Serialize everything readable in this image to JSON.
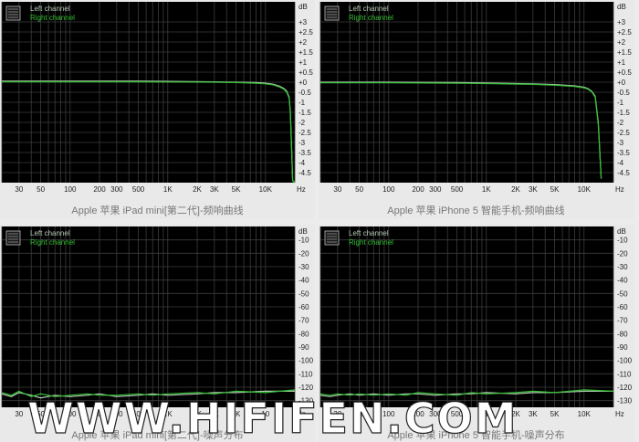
{
  "legend": {
    "left": "Left channel",
    "right": "Right channel"
  },
  "colors": {
    "plot_bg": "#000000",
    "grid": "#3c3c3c",
    "left": "#b7c9b7",
    "right": "#33c033"
  },
  "watermark": "WWW.HIFIFEN.COM",
  "chart_data": [
    {
      "type": "line",
      "title": "",
      "caption": "Apple 苹果 iPad mini[第二代]-频响曲线",
      "unit_label": "dB",
      "x_unit_label": "Hz",
      "x_scale": "log",
      "xlim": [
        20,
        20000
      ],
      "ylim": [
        -5,
        4
      ],
      "x_ticks": [
        30,
        50,
        100,
        200,
        300,
        500,
        1000,
        2000,
        3000,
        5000,
        10000
      ],
      "x_tick_labels": [
        "30",
        "50",
        "100",
        "200",
        "300",
        "500",
        "1K",
        "2K",
        "3K",
        "5K",
        "10K"
      ],
      "y_ticks": [
        3,
        2.5,
        2,
        1.5,
        1,
        0.5,
        0,
        -0.5,
        -1,
        -1.5,
        -2,
        -2.5,
        -3,
        -3.5,
        -4,
        -4.5
      ],
      "y_tick_labels": [
        "+3",
        "+2.5",
        "+2",
        "+1.5",
        "+1",
        "+0.5",
        "+0",
        "-0.5",
        "-1",
        "-1.5",
        "-2",
        "-2.5",
        "-3",
        "-3.5",
        "-4",
        "-4.5"
      ],
      "series": [
        {
          "name": "Left channel",
          "x": [
            20,
            50,
            100,
            500,
            1000,
            3000,
            5000,
            8000,
            10000,
            12000,
            14000,
            15500,
            16500,
            17500,
            18000,
            18500,
            19000,
            20000
          ],
          "y": [
            0.05,
            0.05,
            0.05,
            0.05,
            0.04,
            0.02,
            0,
            -0.02,
            -0.05,
            -0.1,
            -0.2,
            -0.32,
            -0.45,
            -0.75,
            -1.5,
            -3.2,
            -4.9,
            -5
          ]
        },
        {
          "name": "Right channel",
          "x": [
            20,
            50,
            100,
            500,
            1000,
            3000,
            5000,
            8000,
            10000,
            12000,
            14000,
            15500,
            16500,
            17500,
            18000,
            18500,
            19000,
            20000
          ],
          "y": [
            0.02,
            0.02,
            0.02,
            0.02,
            0.01,
            0,
            -0.02,
            -0.05,
            -0.08,
            -0.13,
            -0.24,
            -0.36,
            -0.5,
            -0.8,
            -1.6,
            -3.3,
            -4.9,
            -5
          ]
        }
      ]
    },
    {
      "type": "line",
      "title": "",
      "caption": "Apple 苹果 iPhone 5 智能手机-频响曲线",
      "unit_label": "dB",
      "x_unit_label": "Hz",
      "x_scale": "log",
      "xlim": [
        20,
        20000
      ],
      "ylim": [
        -5,
        4
      ],
      "x_ticks": [
        30,
        50,
        100,
        200,
        300,
        500,
        1000,
        2000,
        3000,
        5000,
        10000
      ],
      "x_tick_labels": [
        "30",
        "50",
        "100",
        "200",
        "300",
        "500",
        "1K",
        "2K",
        "3K",
        "5K",
        "10K"
      ],
      "y_ticks": [
        3,
        2.5,
        2,
        1.5,
        1,
        0.5,
        0,
        -0.5,
        -1,
        -1.5,
        -2,
        -2.5,
        -3,
        -3.5,
        -4,
        -4.5
      ],
      "y_tick_labels": [
        "+3",
        "+2.5",
        "+2",
        "+1.5",
        "+1",
        "+0.5",
        "+0",
        "-0.5",
        "-1",
        "-1.5",
        "-2",
        "-2.5",
        "-3",
        "-3.5",
        "-4",
        "-4.5"
      ],
      "series": [
        {
          "name": "Left channel",
          "x": [
            20,
            50,
            100,
            500,
            1000,
            3000,
            5000,
            8000,
            10000,
            11000,
            12000,
            13000,
            14000,
            15000
          ],
          "y": [
            0.0,
            0.0,
            0.0,
            -0.02,
            -0.04,
            -0.08,
            -0.12,
            -0.18,
            -0.25,
            -0.32,
            -0.45,
            -0.7,
            -2.0,
            -4.8
          ]
        },
        {
          "name": "Right channel",
          "x": [
            20,
            50,
            100,
            500,
            1000,
            3000,
            5000,
            8000,
            10000,
            11000,
            12000,
            13000,
            14000,
            15000
          ],
          "y": [
            -0.03,
            -0.03,
            -0.03,
            -0.05,
            -0.07,
            -0.11,
            -0.15,
            -0.21,
            -0.28,
            -0.35,
            -0.48,
            -0.75,
            -2.1,
            -4.8
          ]
        }
      ]
    },
    {
      "type": "line",
      "title": "",
      "caption": "Apple 苹果 iPad mini[第二代]-噪声分布",
      "unit_label": "dB",
      "x_unit_label": "Hz",
      "x_scale": "log",
      "xlim": [
        20,
        20000
      ],
      "ylim": [
        -135,
        0
      ],
      "x_ticks": [
        30,
        50,
        100,
        200,
        300,
        500,
        1000,
        2000,
        3000,
        5000,
        10000
      ],
      "x_tick_labels": [
        "30",
        "50",
        "100",
        "200",
        "300",
        "500",
        "1K",
        "2K",
        "3K",
        "5K",
        "10"
      ],
      "y_ticks": [
        -10,
        -20,
        -30,
        -40,
        -50,
        -60,
        -70,
        -80,
        -90,
        -100,
        -110,
        -120,
        -130
      ],
      "y_tick_labels": [
        "-10",
        "-20",
        "-30",
        "-40",
        "-50",
        "-60",
        "-70",
        "-80",
        "-90",
        "-100",
        "-110",
        "-120",
        "-130"
      ],
      "series": [
        {
          "name": "Left channel",
          "x": [
            20,
            25,
            30,
            40,
            50,
            70,
            100,
            150,
            200,
            300,
            500,
            700,
            1000,
            2000,
            3000,
            5000,
            10000,
            20000
          ],
          "y": [
            -125,
            -127,
            -124,
            -126,
            -128,
            -126,
            -127,
            -126,
            -125,
            -127,
            -126,
            -125,
            -126,
            -125,
            -124,
            -124,
            -123,
            -123
          ]
        },
        {
          "name": "Right channel",
          "x": [
            20,
            25,
            30,
            40,
            50,
            70,
            100,
            150,
            200,
            300,
            500,
            700,
            1000,
            2000,
            3000,
            5000,
            10000,
            20000
          ],
          "y": [
            -124,
            -126,
            -123,
            -127,
            -125,
            -127,
            -126,
            -125,
            -126,
            -126,
            -125,
            -126,
            -125,
            -124,
            -125,
            -123,
            -124,
            -122
          ]
        }
      ]
    },
    {
      "type": "line",
      "title": "",
      "caption": "Apple 苹果 iPhone 5 智能手机-噪声分布",
      "unit_label": "dB",
      "x_unit_label": "Hz",
      "x_scale": "log",
      "xlim": [
        20,
        20000
      ],
      "ylim": [
        -135,
        0
      ],
      "x_ticks": [
        30,
        50,
        100,
        200,
        300,
        500,
        1000,
        2000,
        3000,
        5000,
        10000
      ],
      "x_tick_labels": [
        "30",
        "50",
        "100",
        "200",
        "300",
        "500",
        "1K",
        "2K",
        "3K",
        "5K",
        "10K"
      ],
      "y_ticks": [
        -10,
        -20,
        -30,
        -40,
        -50,
        -60,
        -70,
        -80,
        -90,
        -100,
        -110,
        -120,
        -130
      ],
      "y_tick_labels": [
        "-10",
        "-20",
        "-30",
        "-40",
        "-50",
        "-60",
        "-70",
        "-80",
        "-90",
        "-100",
        "-110",
        "-120",
        "-130"
      ],
      "series": [
        {
          "name": "Left channel",
          "x": [
            20,
            25,
            30,
            40,
            50,
            70,
            100,
            150,
            200,
            300,
            500,
            700,
            1000,
            2000,
            3000,
            5000,
            10000,
            20000
          ],
          "y": [
            -126,
            -127,
            -126,
            -125,
            -126,
            -125,
            -126,
            -125,
            -125,
            -126,
            -125,
            -125,
            -124,
            -125,
            -124,
            -124,
            -123,
            -123
          ]
        },
        {
          "name": "Right channel",
          "x": [
            20,
            25,
            30,
            40,
            50,
            70,
            100,
            150,
            200,
            300,
            500,
            700,
            1000,
            2000,
            3000,
            5000,
            10000,
            20000
          ],
          "y": [
            -125,
            -126,
            -125,
            -126,
            -125,
            -126,
            -125,
            -126,
            -124,
            -125,
            -126,
            -124,
            -125,
            -124,
            -123,
            -124,
            -122,
            -123
          ]
        }
      ]
    }
  ]
}
